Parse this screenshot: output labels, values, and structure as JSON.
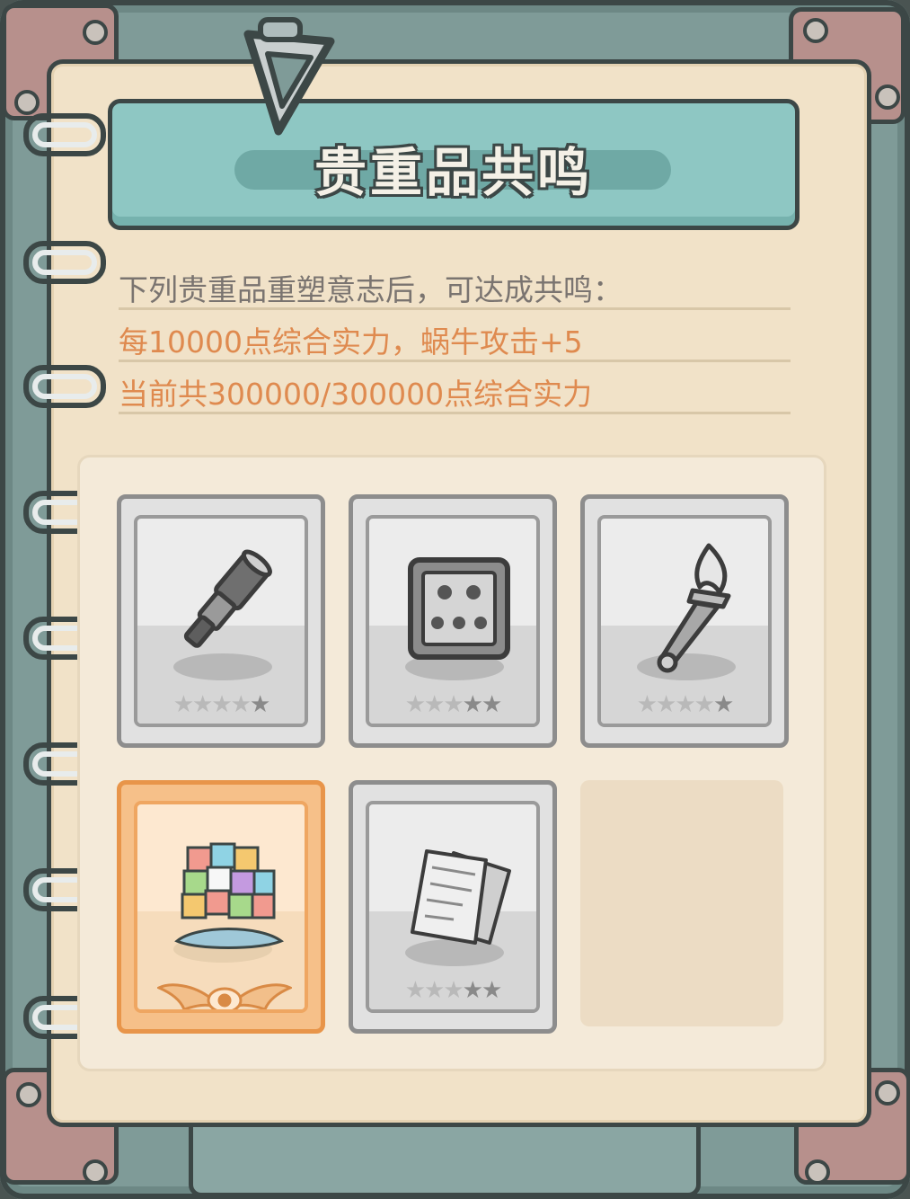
{
  "title": "贵重品共鸣",
  "description": {
    "line1": "下列贵重品重塑意志后，可达成共鸣：",
    "line2": "每10000点综合实力，蜗牛攻击+5",
    "line3": "当前共300000/300000点综合实力"
  },
  "items": [
    {
      "name": "spyglass",
      "icon": "spyglass-icon",
      "stars_filled": 4,
      "stars_total": 5,
      "owned": false
    },
    {
      "name": "beetle-box",
      "icon": "beetle-box-icon",
      "stars_filled": 3,
      "stars_total": 5,
      "owned": false
    },
    {
      "name": "torch",
      "icon": "torch-icon",
      "stars_filled": 4,
      "stars_total": 5,
      "owned": false
    },
    {
      "name": "gem-cube",
      "icon": "gem-cube-icon",
      "owned": true,
      "badge_icon": "winged-eye-icon"
    },
    {
      "name": "documents",
      "icon": "documents-icon",
      "stars_filled": 3,
      "stars_total": 5,
      "owned": false
    }
  ],
  "colors": {
    "accent_orange": "#df8a4f",
    "banner_teal": "#8ec7c3",
    "page": "#f1e2c8"
  }
}
